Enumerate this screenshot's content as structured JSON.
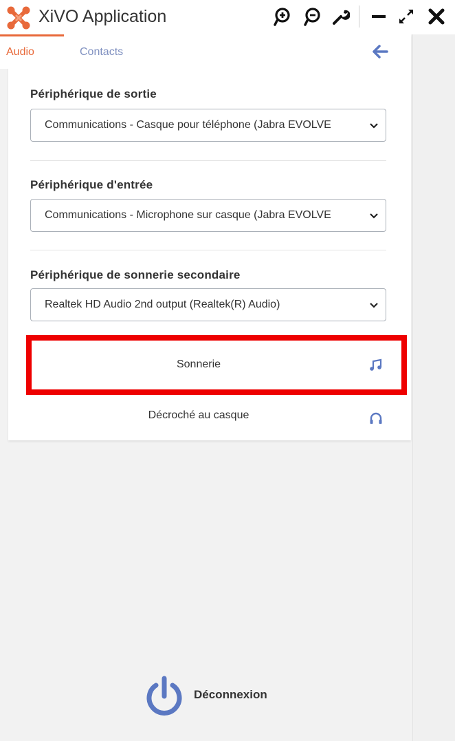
{
  "app": {
    "title": "XiVO Application"
  },
  "titlebar": {
    "icons": [
      "zoom-in-icon",
      "zoom-out-icon",
      "wrench-icon",
      "minimize-icon",
      "expand-icon",
      "close-icon"
    ]
  },
  "tabs": [
    {
      "label": "Audio",
      "active": true
    },
    {
      "label": "Contacts",
      "active": false
    }
  ],
  "audio": {
    "output": {
      "label": "Périphérique de sortie",
      "value": "Communications - Casque pour téléphone (Jabra EVOLVE"
    },
    "input": {
      "label": "Périphérique d'entrée",
      "value": "Communications - Microphone sur casque (Jabra EVOLVE"
    },
    "ring": {
      "label": "Périphérique de sonnerie secondaire",
      "value": "Realtek HD Audio 2nd output (Realtek(R) Audio)"
    },
    "ringtone": {
      "label": "Sonnerie",
      "icon": "music-note-icon"
    },
    "headset_answer": {
      "label": "Décroché au casque",
      "icon": "headphones-icon"
    }
  },
  "logout": {
    "label": "Déconnexion",
    "icon": "power-icon"
  },
  "colors": {
    "accent": "#e8693a",
    "blue": "#5b78c2",
    "highlight": "#ee0000",
    "tab_inactive": "#7f90c0"
  }
}
